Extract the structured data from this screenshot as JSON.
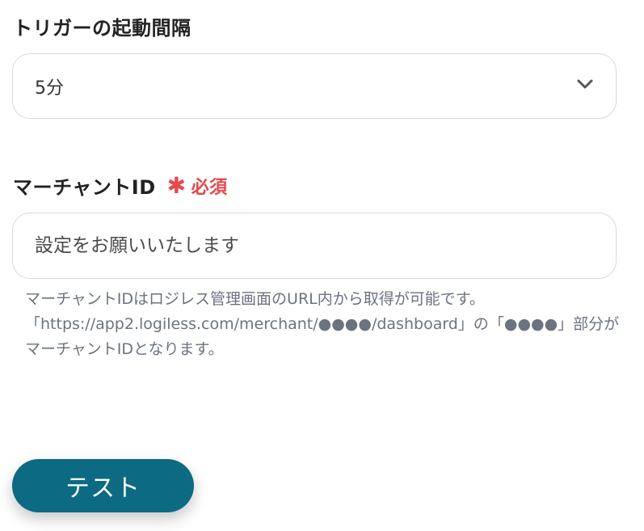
{
  "trigger": {
    "label": "トリガーの起動間隔",
    "selected_value": "5分"
  },
  "merchant": {
    "label": "マーチャントID",
    "required_text": "必須",
    "placeholder": "設定をお願いいたします",
    "help_line1": "マーチャントIDはロジレス管理画面のURL内から取得が可能です。",
    "help_line2": "「https://app2.logiless.com/merchant/●●●●/dashboard」の「●●●●」部分がマーチャントIDとなります。"
  },
  "actions": {
    "test_label": "テスト"
  },
  "icons": {
    "select_chevron": "chevron-down-icon",
    "required_marker": "asterisk-icon"
  },
  "colors": {
    "primary_button": "#0c6a82",
    "required": "#e5484d",
    "border": "#d6d9de",
    "help_text": "#6b7280"
  }
}
